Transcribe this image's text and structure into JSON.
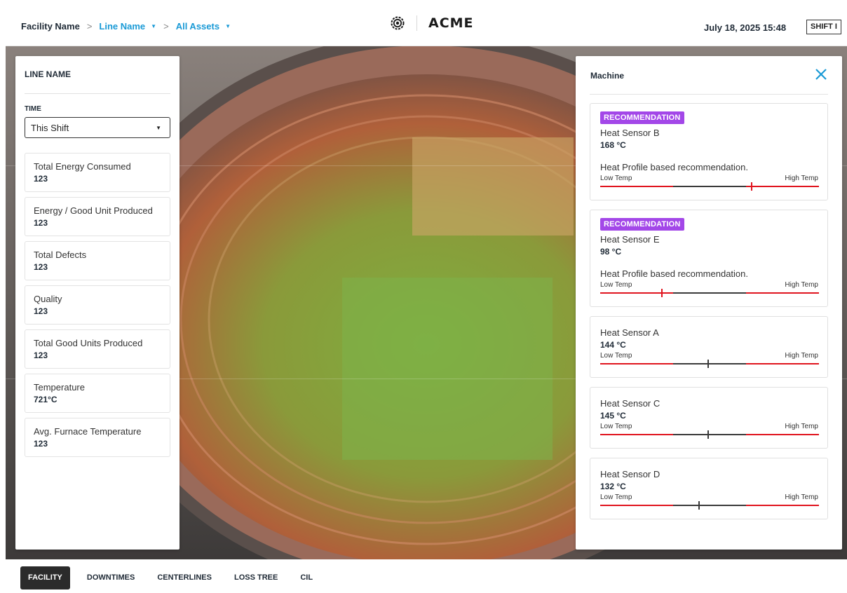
{
  "header": {
    "breadcrumb": {
      "facility": "Facility Name",
      "separator": ">",
      "line": "Line Name",
      "assets": "All Assets"
    },
    "brand": "ACME",
    "datetime": "July 18, 2025 15:48",
    "shift": "SHIFT I"
  },
  "left_panel": {
    "title": "LINE NAME",
    "time_label": "TIME",
    "time_selected": "This Shift",
    "metrics": [
      {
        "label": "Total Energy Consumed",
        "value": "123"
      },
      {
        "label": "Energy / Good Unit Produced",
        "value": "123"
      },
      {
        "label": "Total Defects",
        "value": "123"
      },
      {
        "label": "Quality",
        "value": "123"
      },
      {
        "label": "Total Good Units Produced",
        "value": "123"
      },
      {
        "label": "Temperature",
        "value": "721°C"
      },
      {
        "label": "Avg. Furnace Temperature",
        "value": "123"
      }
    ]
  },
  "right_panel": {
    "title": "Machine",
    "low_label": "Low Temp",
    "high_label": "High Temp",
    "sensors": [
      {
        "badge": "RECOMMENDATION",
        "name": "Heat Sensor B",
        "temp": "168 °C",
        "note": "Heat Profile based recommendation.",
        "level": 0.69,
        "state": "alert"
      },
      {
        "badge": "RECOMMENDATION",
        "name": "Heat Sensor E",
        "temp": "98 °C",
        "note": "Heat Profile based recommendation.",
        "level": 0.28,
        "state": "alert"
      },
      {
        "badge": "",
        "name": "Heat Sensor A",
        "temp": "144 °C",
        "note": "",
        "level": 0.49,
        "state": "normal"
      },
      {
        "badge": "",
        "name": "Heat Sensor C",
        "temp": "145 °C",
        "note": "",
        "level": 0.49,
        "state": "normal"
      },
      {
        "badge": "",
        "name": "Heat Sensor D",
        "temp": "132 °C",
        "note": "",
        "level": 0.45,
        "state": "normal"
      }
    ]
  },
  "tabs": [
    {
      "label": "FACILITY",
      "active": true
    },
    {
      "label": "DOWNTIMES",
      "active": false
    },
    {
      "label": "CENTERLINES",
      "active": false
    },
    {
      "label": "LOSS TREE",
      "active": false
    },
    {
      "label": "CIL",
      "active": false
    }
  ],
  "colors": {
    "accent": "#1a9ad6",
    "recommendation": "#a347e8",
    "range_red": "#e0141e",
    "range_dark": "#3a3a3a"
  },
  "icons": {
    "logo": "gear-logo-icon",
    "close": "close-icon",
    "caret": "caret-down-icon"
  }
}
